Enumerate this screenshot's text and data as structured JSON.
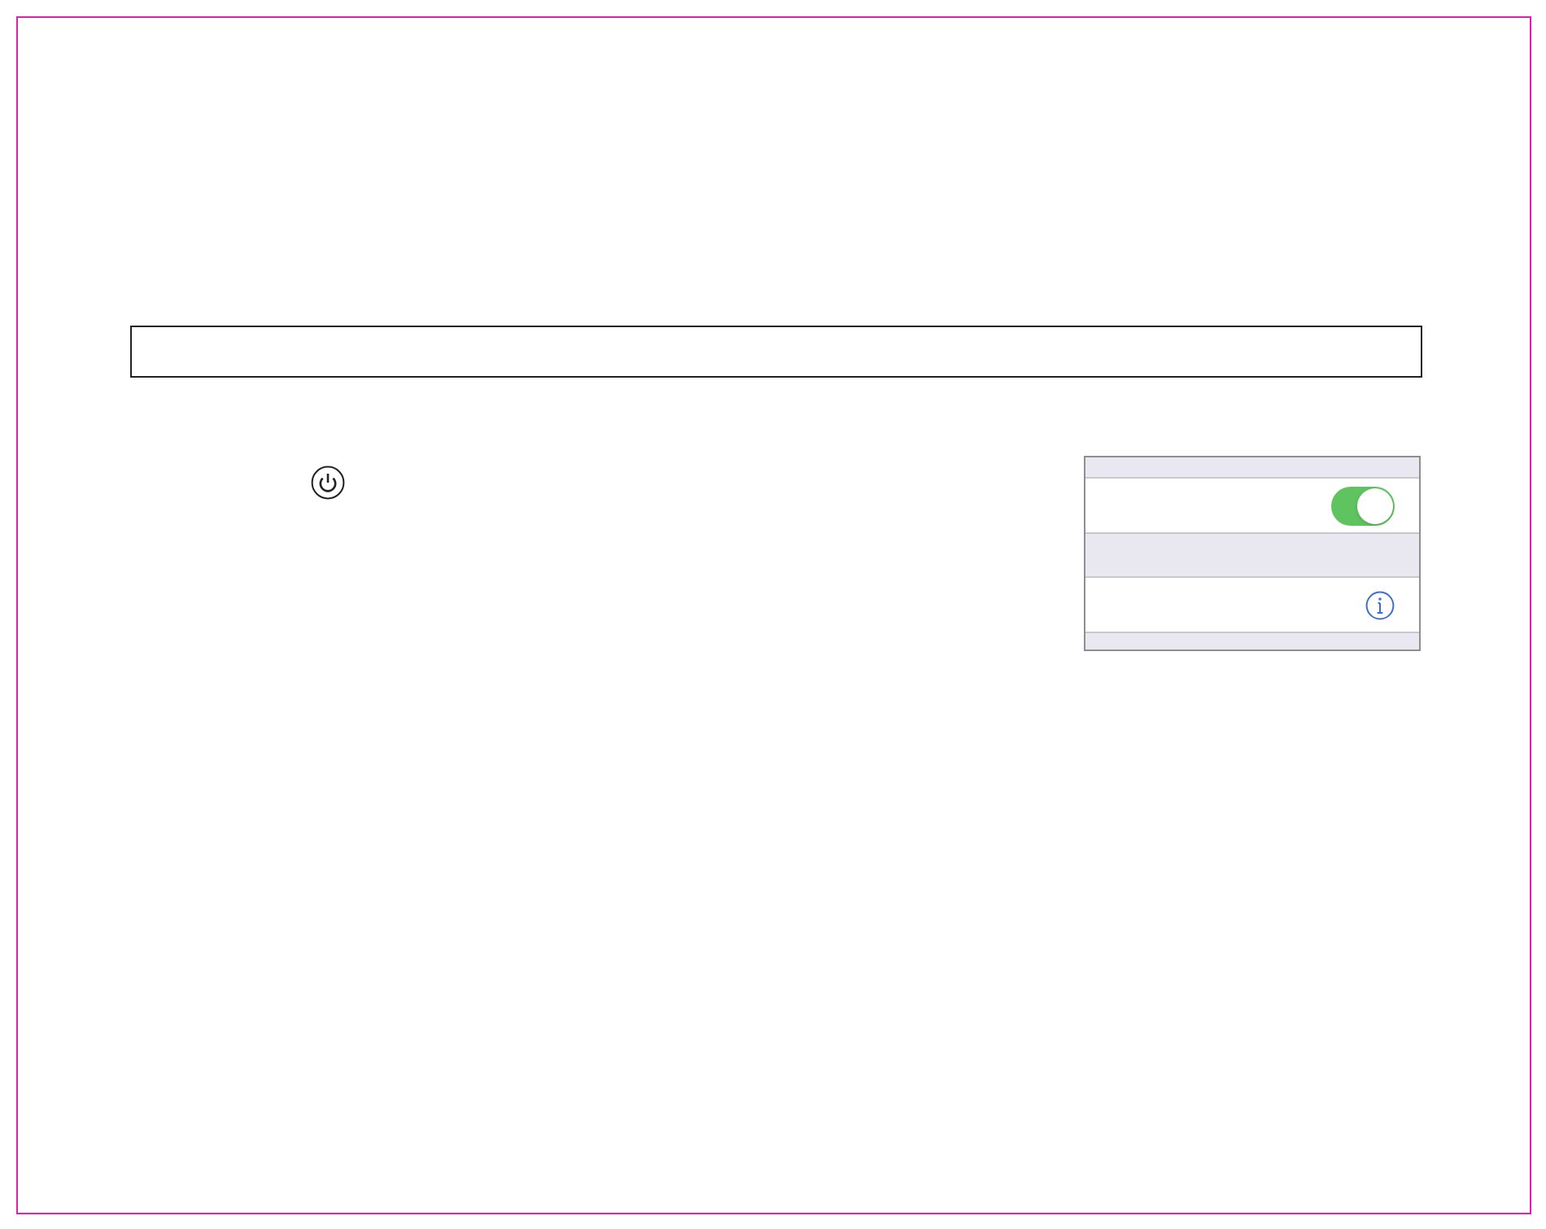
{
  "settings_panel": {
    "rows": [
      {
        "kind": "toggle",
        "on": true
      },
      {
        "kind": "info"
      }
    ]
  }
}
